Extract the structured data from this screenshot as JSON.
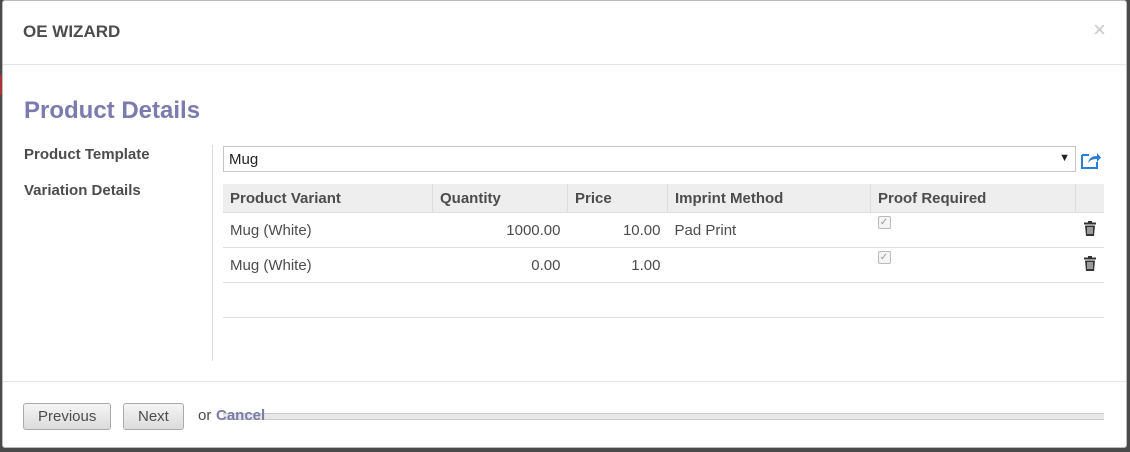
{
  "dialog": {
    "title": "OE WIZARD",
    "close_glyph": "×"
  },
  "form": {
    "section_title": "Product Details",
    "product_template_label": "Product Template",
    "variation_details_label": "Variation Details",
    "product_template_value": "Mug"
  },
  "table": {
    "headers": [
      "Product Variant",
      "Quantity",
      "Price",
      "Imprint Method",
      "Proof Required"
    ],
    "rows": [
      {
        "variant": "Mug (White)",
        "quantity": "1000.00",
        "price": "10.00",
        "imprint": "Pad Print",
        "proof_required": true
      },
      {
        "variant": "Mug (White)",
        "quantity": "0.00",
        "price": "1.00",
        "imprint": "",
        "proof_required": true
      }
    ]
  },
  "footer": {
    "previous_label": "Previous",
    "next_label": "Next",
    "or_text": "or",
    "cancel_label": "Cancel"
  },
  "colors": {
    "accent": "#7c7bad",
    "link_icon": "#2a7fd5"
  },
  "icons": {
    "external": "external-link-icon",
    "delete": "trash-icon",
    "close": "close-icon"
  }
}
